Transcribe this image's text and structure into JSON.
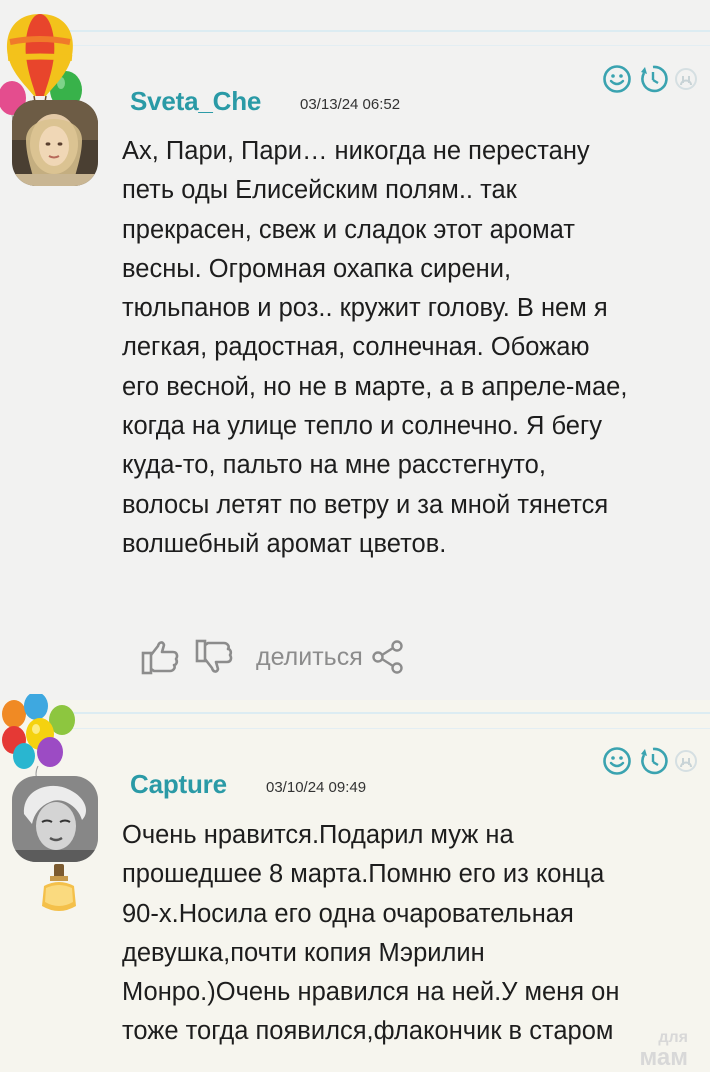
{
  "comments": [
    {
      "username": "Sveta_Che",
      "date": "03/13/24 06:52",
      "text": "Ах, Пари, Пари… никогда не перестану\nпеть оды Елисейским полям.. так\nпрекрасен, свеж и сладок этот аромат\nвесны. Огромная охапка сирени,\nтюльпанов и роз.. кружит голову. В нем я\nлегкая, радостная, солнечная. Обожаю\nего весной, но не в марте, а в апреле-мае,\nкогда на улице тепло и солнечно. Я бегу\nкуда-то, пальто на мне расстегнуто,\nволосы летят по ветру и за мной тянется\nволшебный аромат цветов.",
      "share_label": "делиться",
      "icons": [
        "smiley-icon",
        "clock-icon",
        "user-icon"
      ],
      "badge": "single-balloon-icon"
    },
    {
      "username": "Capture",
      "date": "03/10/24 09:49",
      "text": "Очень нравится.Подарил муж на\nпрошедшее 8 марта.Помню его из конца\n90-х.Носила его одна очаровательная\nдевушка,почти копия Мэрилин\nМонро.)Очень нравился на ней.У меня он\nтоже тогда появился,флакончик в старом",
      "icons": [
        "smiley-icon",
        "clock-icon",
        "user-icon"
      ],
      "badge": "balloon-bunch-icon"
    }
  ],
  "watermark": {
    "line1": "для",
    "line2": "мам"
  },
  "colors": {
    "username": "#2a9aa6",
    "icon": "#3aa3b0",
    "text": "#1d1d1d",
    "action_gray": "#8c8c8c"
  }
}
